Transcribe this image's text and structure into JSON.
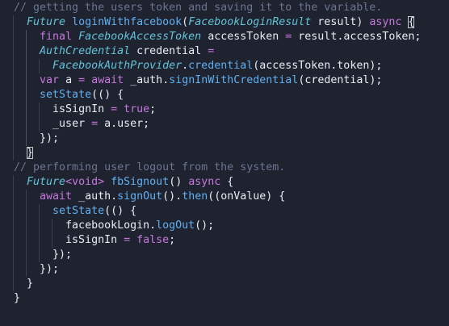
{
  "editor": {
    "background": "#1f2330",
    "lines": [
      {
        "indent": 0,
        "tokens": [
          {
            "text": "// getting the users token and saving it to the variable.",
            "cls": "t-comment"
          }
        ]
      },
      {
        "indent": 1,
        "tokens": [
          {
            "text": "Future",
            "cls": "t-type"
          },
          {
            "text": " ",
            "cls": "t-plain"
          },
          {
            "text": "loginWithfacebook",
            "cls": "t-func"
          },
          {
            "text": "(",
            "cls": "t-punct"
          },
          {
            "text": "FacebookLoginResult",
            "cls": "t-type"
          },
          {
            "text": " result) ",
            "cls": "t-plain"
          },
          {
            "text": "async",
            "cls": "t-keyword"
          },
          {
            "text": " ",
            "cls": "t-plain"
          },
          {
            "text": "{",
            "cls": "t-punct t-bracket-hl"
          }
        ]
      },
      {
        "indent": 2,
        "tokens": [
          {
            "text": "final",
            "cls": "t-keyword"
          },
          {
            "text": " ",
            "cls": "t-plain"
          },
          {
            "text": "FacebookAccessToken",
            "cls": "t-type"
          },
          {
            "text": " accessToken ",
            "cls": "t-plain"
          },
          {
            "text": "=",
            "cls": "t-op"
          },
          {
            "text": " result.accessToken;",
            "cls": "t-plain"
          }
        ]
      },
      {
        "indent": 2,
        "tokens": [
          {
            "text": "AuthCredential",
            "cls": "t-type"
          },
          {
            "text": " credential ",
            "cls": "t-plain"
          },
          {
            "text": "=",
            "cls": "t-op"
          }
        ]
      },
      {
        "indent": 3,
        "tokens": [
          {
            "text": "FacebookAuthProvider",
            "cls": "t-type"
          },
          {
            "text": ".",
            "cls": "t-punct"
          },
          {
            "text": "credential",
            "cls": "t-func"
          },
          {
            "text": "(accessToken.token);",
            "cls": "t-plain"
          }
        ]
      },
      {
        "indent": 2,
        "tokens": [
          {
            "text": "var",
            "cls": "t-keyword"
          },
          {
            "text": " a ",
            "cls": "t-plain"
          },
          {
            "text": "=",
            "cls": "t-op"
          },
          {
            "text": " ",
            "cls": "t-plain"
          },
          {
            "text": "await",
            "cls": "t-keyword"
          },
          {
            "text": " _auth.",
            "cls": "t-plain"
          },
          {
            "text": "signInWithCredential",
            "cls": "t-func"
          },
          {
            "text": "(credential);",
            "cls": "t-plain"
          }
        ]
      },
      {
        "indent": 2,
        "tokens": [
          {
            "text": "setState",
            "cls": "t-func"
          },
          {
            "text": "(() {",
            "cls": "t-plain"
          }
        ]
      },
      {
        "indent": 3,
        "tokens": [
          {
            "text": "isSignIn ",
            "cls": "t-plain"
          },
          {
            "text": "=",
            "cls": "t-op"
          },
          {
            "text": " ",
            "cls": "t-plain"
          },
          {
            "text": "true",
            "cls": "t-keyword"
          },
          {
            "text": ";",
            "cls": "t-plain"
          }
        ]
      },
      {
        "indent": 3,
        "tokens": [
          {
            "text": "_user ",
            "cls": "t-plain"
          },
          {
            "text": "=",
            "cls": "t-op"
          },
          {
            "text": " a.user;",
            "cls": "t-plain"
          }
        ]
      },
      {
        "indent": 2,
        "tokens": [
          {
            "text": "});",
            "cls": "t-plain"
          }
        ]
      },
      {
        "indent": 1,
        "tokens": [
          {
            "text": "}",
            "cls": "t-punct t-bracket-hl"
          }
        ]
      },
      {
        "indent": 0,
        "tokens": [
          {
            "text": "// performing user logout from the system.",
            "cls": "t-comment"
          }
        ]
      },
      {
        "indent": 1,
        "tokens": [
          {
            "text": "Future",
            "cls": "t-type"
          },
          {
            "text": "<",
            "cls": "t-keyword"
          },
          {
            "text": "void",
            "cls": "t-keyword"
          },
          {
            "text": ">",
            "cls": "t-keyword"
          },
          {
            "text": " ",
            "cls": "t-plain"
          },
          {
            "text": "fbSignout",
            "cls": "t-func"
          },
          {
            "text": "() ",
            "cls": "t-plain"
          },
          {
            "text": "async",
            "cls": "t-keyword"
          },
          {
            "text": " {",
            "cls": "t-plain"
          }
        ]
      },
      {
        "indent": 2,
        "tokens": [
          {
            "text": "await",
            "cls": "t-keyword"
          },
          {
            "text": " _auth.",
            "cls": "t-plain"
          },
          {
            "text": "signOut",
            "cls": "t-func"
          },
          {
            "text": "().",
            "cls": "t-plain"
          },
          {
            "text": "then",
            "cls": "t-func"
          },
          {
            "text": "((onValue) {",
            "cls": "t-plain"
          }
        ]
      },
      {
        "indent": 3,
        "tokens": [
          {
            "text": "setState",
            "cls": "t-func"
          },
          {
            "text": "(() {",
            "cls": "t-plain"
          }
        ]
      },
      {
        "indent": 4,
        "tokens": [
          {
            "text": "facebookLogin.",
            "cls": "t-plain"
          },
          {
            "text": "logOut",
            "cls": "t-func"
          },
          {
            "text": "();",
            "cls": "t-plain"
          }
        ]
      },
      {
        "indent": 4,
        "tokens": [
          {
            "text": "isSignIn ",
            "cls": "t-plain"
          },
          {
            "text": "=",
            "cls": "t-op"
          },
          {
            "text": " ",
            "cls": "t-plain"
          },
          {
            "text": "false",
            "cls": "t-keyword"
          },
          {
            "text": ";",
            "cls": "t-plain"
          }
        ]
      },
      {
        "indent": 3,
        "tokens": [
          {
            "text": "});",
            "cls": "t-plain"
          }
        ]
      },
      {
        "indent": 2,
        "tokens": [
          {
            "text": "});",
            "cls": "t-plain"
          }
        ]
      },
      {
        "indent": 1,
        "tokens": [
          {
            "text": "}",
            "cls": "t-plain"
          }
        ]
      },
      {
        "indent": 0,
        "tokens": [
          {
            "text": "}",
            "cls": "t-plain"
          }
        ]
      }
    ]
  }
}
